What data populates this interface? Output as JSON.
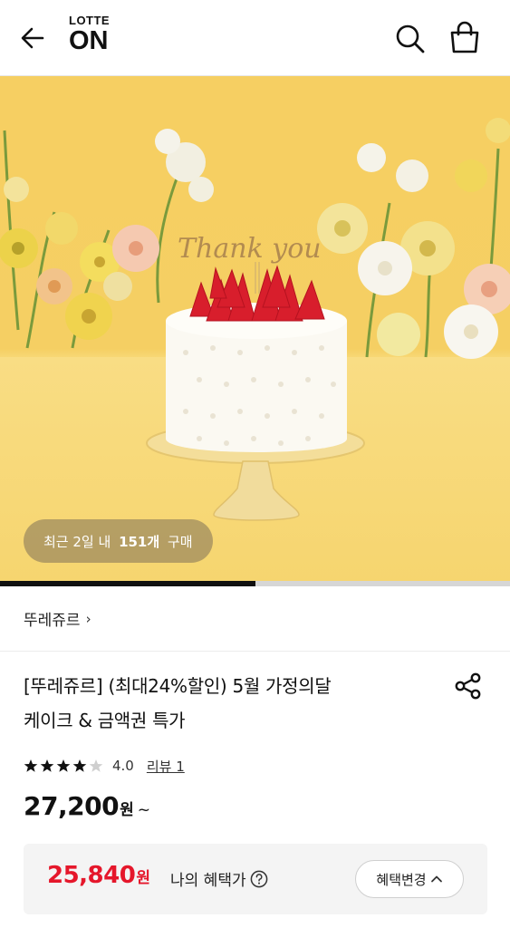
{
  "header": {
    "logo_top": "LOTTE",
    "logo_main": "ON",
    "icons": [
      "arrow-left-icon",
      "search-icon",
      "shopping-bag-icon"
    ]
  },
  "hero": {
    "cake_topper_text": "Thank you",
    "purchase_prefix": "최근 2일 내 ",
    "purchase_count": "151개",
    "purchase_suffix": " 구매",
    "progress": 0.5
  },
  "store": {
    "name": "뚜레쥬르",
    "chevron": "›"
  },
  "product": {
    "title_line1": "[뚜레쥬르] (최대24%할인) 5월 가정의달",
    "title_line2": "케이크 & 금액권 특가",
    "rating_stars": 4,
    "rating_value": "4.0",
    "review_label": "리뷰 1",
    "price": "27,200",
    "price_unit": "원",
    "price_suffix": "~"
  },
  "benefit": {
    "price": "25,840",
    "unit": "원",
    "label": "나의 혜택가",
    "change_label": "혜택변경",
    "accent_color": "#e5172b"
  }
}
